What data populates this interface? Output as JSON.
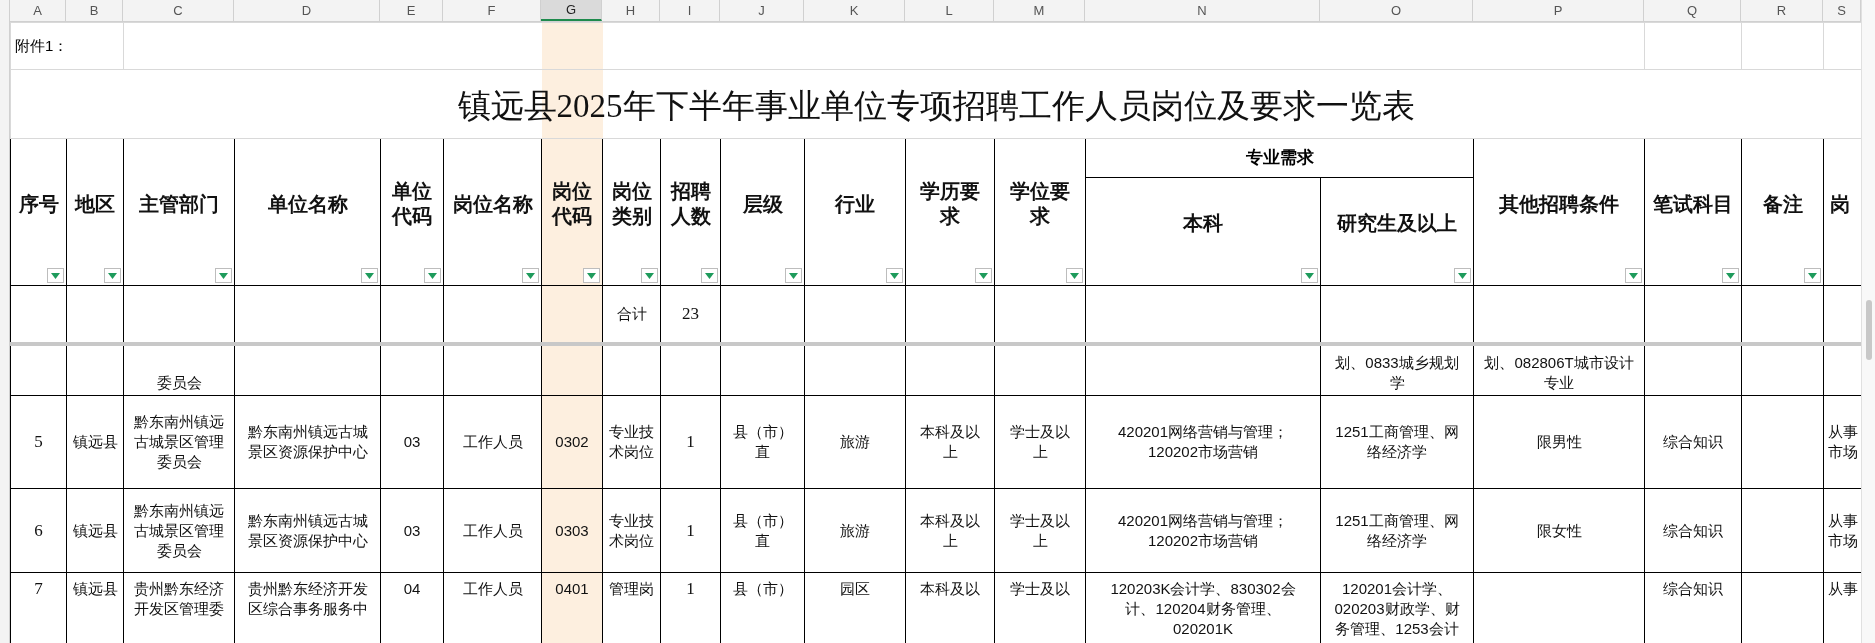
{
  "column_headers": [
    {
      "label": "A",
      "selected": false
    },
    {
      "label": "B",
      "selected": false
    },
    {
      "label": "C",
      "selected": false
    },
    {
      "label": "D",
      "selected": false
    },
    {
      "label": "E",
      "selected": false
    },
    {
      "label": "F",
      "selected": false
    },
    {
      "label": "G",
      "selected": true
    },
    {
      "label": "H",
      "selected": false
    },
    {
      "label": "I",
      "selected": false
    },
    {
      "label": "J",
      "selected": false
    },
    {
      "label": "K",
      "selected": false
    },
    {
      "label": "L",
      "selected": false
    },
    {
      "label": "M",
      "selected": false
    },
    {
      "label": "N",
      "selected": false
    },
    {
      "label": "O",
      "selected": false
    },
    {
      "label": "P",
      "selected": false
    },
    {
      "label": "Q",
      "selected": false
    },
    {
      "label": "R",
      "selected": false
    },
    {
      "label": "S",
      "selected": false
    }
  ],
  "note": "附件1：",
  "title": "镇远县2025年下半年事业单位专项招聘工作人员岗位及要求一览表",
  "group_header": "专业需求",
  "columns": [
    {
      "label": "序号",
      "filter": true,
      "grouped": false
    },
    {
      "label": "地区",
      "filter": true,
      "grouped": false
    },
    {
      "label": "主管部门",
      "filter": true,
      "grouped": false
    },
    {
      "label": "单位名称",
      "filter": true,
      "grouped": false
    },
    {
      "label": "单位代码",
      "filter": true,
      "grouped": false
    },
    {
      "label": "岗位名称",
      "filter": true,
      "grouped": false
    },
    {
      "label": "岗位代码",
      "filter": true,
      "grouped": false
    },
    {
      "label": "岗位类别",
      "filter": true,
      "grouped": false
    },
    {
      "label": "招聘人数",
      "filter": true,
      "grouped": false
    },
    {
      "label": "层级",
      "filter": true,
      "grouped": false
    },
    {
      "label": "行业",
      "filter": true,
      "grouped": false
    },
    {
      "label": "学历要求",
      "filter": true,
      "grouped": false
    },
    {
      "label": "学位要求",
      "filter": true,
      "grouped": false
    },
    {
      "label": "本科",
      "filter": true,
      "grouped": true
    },
    {
      "label": "研究生及以上",
      "filter": true,
      "grouped": true
    },
    {
      "label": "其他招聘条件",
      "filter": true,
      "grouped": false
    },
    {
      "label": "笔试科目",
      "filter": true,
      "grouped": false
    },
    {
      "label": "备注",
      "filter": true,
      "grouped": false
    },
    {
      "label": "岗",
      "filter": false,
      "grouped": false
    }
  ],
  "rows": [
    {
      "kind": "total",
      "cells": [
        null,
        null,
        null,
        null,
        null,
        null,
        null,
        "合计",
        "23",
        null,
        null,
        null,
        null,
        null,
        null,
        null,
        null,
        null,
        null
      ]
    },
    {
      "kind": "cut_top",
      "cells": [
        null,
        null,
        "委员会",
        null,
        null,
        null,
        null,
        null,
        null,
        null,
        null,
        null,
        null,
        null,
        "划、0833城乡规划学",
        "划、082806T城市设计专业",
        null,
        null,
        null
      ]
    },
    {
      "kind": "full",
      "cells": [
        "5",
        "镇远县",
        "黔东南州镇远古城景区管理委员会",
        "黔东南州镇远古城景区资源保护中心",
        "03",
        "工作人员",
        "0302",
        "专业技术岗位",
        "1",
        "县（市）直",
        "旅游",
        "本科及以上",
        "学士及以上",
        "420201网络营销与管理；120202市场营销",
        "1251工商管理、网络经济学",
        "限男性",
        "综合知识",
        null,
        "从事市场"
      ]
    },
    {
      "kind": "full",
      "cells": [
        "6",
        "镇远县",
        "黔东南州镇远古城景区管理委员会",
        "黔东南州镇远古城景区资源保护中心",
        "03",
        "工作人员",
        "0303",
        "专业技术岗位",
        "1",
        "县（市）直",
        "旅游",
        "本科及以上",
        "学士及以上",
        "420201网络营销与管理；120202市场营销",
        "1251工商管理、网络经济学",
        "限女性",
        "综合知识",
        null,
        "从事市场"
      ]
    },
    {
      "kind": "cut_bottom",
      "cells": [
        "7",
        "镇远县",
        "贵州黔东经济开发区管理委",
        "贵州黔东经济开发区综合事务服务中",
        "04",
        "工作人员",
        "0401",
        "管理岗",
        "1",
        "县（市）",
        "园区",
        "本科及以",
        "学士及以",
        "120203K会计学、830302会计、120204财务管理、020201K",
        "120201会计学、020203财政学、财务管理、1253会计",
        null,
        "综合知识",
        null,
        "从事"
      ]
    }
  ]
}
